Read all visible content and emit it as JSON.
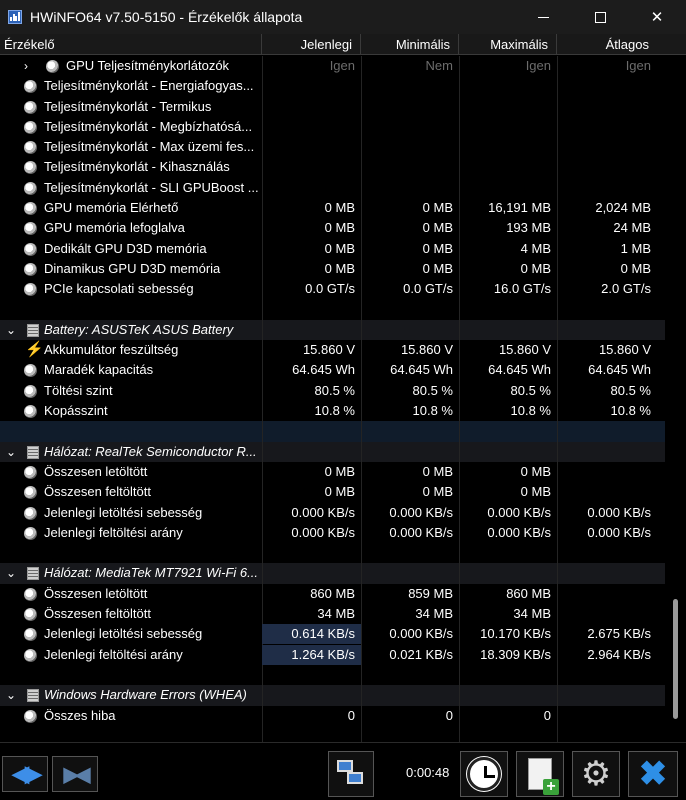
{
  "window": {
    "title": "HWiNFO64 v7.50-5150 - Érzékelők állapota"
  },
  "header": {
    "columns": [
      "Érzékelő",
      "Jelenlegi",
      "Minimális",
      "Maximális",
      "Átlagos"
    ]
  },
  "rows": [
    {
      "kind": "sensor",
      "label": "GPU Teljesítménykorlátozók",
      "expand": "›",
      "values": [
        "Igen",
        "Nem",
        "Igen",
        "Igen"
      ],
      "grey": true,
      "indent": 1
    },
    {
      "kind": "sensor",
      "label": "Teljesítménykorlát - Energiafogyas...",
      "values": [
        "",
        "",
        "",
        ""
      ]
    },
    {
      "kind": "sensor",
      "label": "Teljesítménykorlát - Termikus",
      "values": [
        "",
        "",
        "",
        ""
      ]
    },
    {
      "kind": "sensor",
      "label": "Teljesítménykorlát - Megbízhatósá...",
      "values": [
        "",
        "",
        "",
        ""
      ]
    },
    {
      "kind": "sensor",
      "label": "Teljesítménykorlát - Max üzemi fes...",
      "values": [
        "",
        "",
        "",
        ""
      ]
    },
    {
      "kind": "sensor",
      "label": "Teljesítménykorlát - Kihasználás",
      "values": [
        "",
        "",
        "",
        ""
      ]
    },
    {
      "kind": "sensor",
      "label": "Teljesítménykorlát - SLI GPUBoost ...",
      "values": [
        "",
        "",
        "",
        ""
      ]
    },
    {
      "kind": "sensor",
      "label": "GPU memória Elérhető",
      "values": [
        "0 MB",
        "0 MB",
        "16,191 MB",
        "2,024 MB"
      ]
    },
    {
      "kind": "sensor",
      "label": "GPU memória lefoglalva",
      "values": [
        "0 MB",
        "0 MB",
        "193 MB",
        "24 MB"
      ]
    },
    {
      "kind": "sensor",
      "label": "Dedikált GPU D3D memória",
      "values": [
        "0 MB",
        "0 MB",
        "4 MB",
        "1 MB"
      ]
    },
    {
      "kind": "sensor",
      "label": "Dinamikus GPU D3D memória",
      "values": [
        "0 MB",
        "0 MB",
        "0 MB",
        "0 MB"
      ]
    },
    {
      "kind": "sensor",
      "label": "PCIe kapcsolati sebesség",
      "values": [
        "0.0 GT/s",
        "0.0 GT/s",
        "16.0 GT/s",
        "2.0 GT/s"
      ]
    },
    {
      "kind": "spacer"
    },
    {
      "kind": "section",
      "label": "Battery: ASUSTeK ASUS Battery",
      "expand": "⌄"
    },
    {
      "kind": "sensor",
      "label": "Akkumulátor feszültség",
      "icon": "bolt",
      "values": [
        "15.860 V",
        "15.860 V",
        "15.860 V",
        "15.860 V"
      ]
    },
    {
      "kind": "sensor",
      "label": "Maradék kapacitás",
      "values": [
        "64.645 Wh",
        "64.645 Wh",
        "64.645 Wh",
        "64.645 Wh"
      ]
    },
    {
      "kind": "sensor",
      "label": "Töltési szint",
      "values": [
        "80.5 %",
        "80.5 %",
        "80.5 %",
        "80.5 %"
      ]
    },
    {
      "kind": "sensor",
      "label": "Kopásszint",
      "values": [
        "10.8 %",
        "10.8 %",
        "10.8 %",
        "10.8 %"
      ]
    },
    {
      "kind": "spacer",
      "dark": true
    },
    {
      "kind": "section",
      "label": "Hálózat: RealTek Semiconductor R...",
      "expand": "⌄"
    },
    {
      "kind": "sensor",
      "label": "Összesen letöltött",
      "values": [
        "0 MB",
        "0 MB",
        "0 MB",
        ""
      ]
    },
    {
      "kind": "sensor",
      "label": "Összesen feltöltött",
      "values": [
        "0 MB",
        "0 MB",
        "0 MB",
        ""
      ]
    },
    {
      "kind": "sensor",
      "label": "Jelenlegi letöltési sebesség",
      "values": [
        "0.000 KB/s",
        "0.000 KB/s",
        "0.000 KB/s",
        "0.000 KB/s"
      ]
    },
    {
      "kind": "sensor",
      "label": "Jelenlegi feltöltési arány",
      "values": [
        "0.000 KB/s",
        "0.000 KB/s",
        "0.000 KB/s",
        "0.000 KB/s"
      ]
    },
    {
      "kind": "spacer"
    },
    {
      "kind": "section",
      "label": "Hálózat: MediaTek MT7921 Wi-Fi 6...",
      "expand": "⌄"
    },
    {
      "kind": "sensor",
      "label": "Összesen letöltött",
      "values": [
        "860 MB",
        "859 MB",
        "860 MB",
        ""
      ]
    },
    {
      "kind": "sensor",
      "label": "Összesen feltöltött",
      "values": [
        "34 MB",
        "34 MB",
        "34 MB",
        ""
      ]
    },
    {
      "kind": "sensor",
      "label": "Jelenlegi letöltési sebesség",
      "values": [
        "0.614 KB/s",
        "0.000 KB/s",
        "10.170 KB/s",
        "2.675 KB/s"
      ],
      "highlight": true
    },
    {
      "kind": "sensor",
      "label": "Jelenlegi feltöltési arány",
      "values": [
        "1.264 KB/s",
        "0.021 KB/s",
        "18.309 KB/s",
        "2.964 KB/s"
      ],
      "highlight": true
    },
    {
      "kind": "spacer"
    },
    {
      "kind": "section",
      "label": "Windows Hardware Errors (WHEA)",
      "expand": "⌄"
    },
    {
      "kind": "sensor",
      "label": "Összes hiba",
      "values": [
        "0",
        "0",
        "0",
        ""
      ]
    },
    {
      "kind": "spacer"
    }
  ],
  "toolbar": {
    "timer": "0:00:48",
    "buttons": [
      "navigate-arrows",
      "collapse-arrows",
      "network-icon",
      "clock-icon",
      "report-icon",
      "settings-icon",
      "close-icon"
    ]
  },
  "scroll": {
    "position_fraction": 0.79
  }
}
